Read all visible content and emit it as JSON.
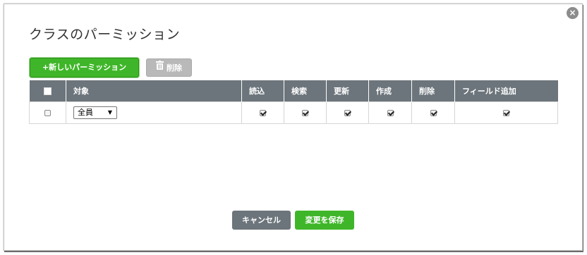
{
  "dialog": {
    "title": "クラスのパーミッション",
    "close_glyph": "×"
  },
  "toolbar": {
    "add_label": "+新しいパーミッション",
    "delete_label": "削除"
  },
  "table": {
    "headers": [
      "対象",
      "読込",
      "検索",
      "更新",
      "作成",
      "削除",
      "フィールド追加"
    ],
    "rows": [
      {
        "selected": false,
        "target": "全員",
        "permissions": [
          true,
          true,
          true,
          true,
          true,
          true
        ]
      }
    ]
  },
  "footer": {
    "cancel_label": "キャンセル",
    "save_label": "変更を保存"
  },
  "colors": {
    "primary_green": "#3fb629",
    "header_gray": "#6c757b",
    "disabled_gray": "#b9b9b9"
  }
}
